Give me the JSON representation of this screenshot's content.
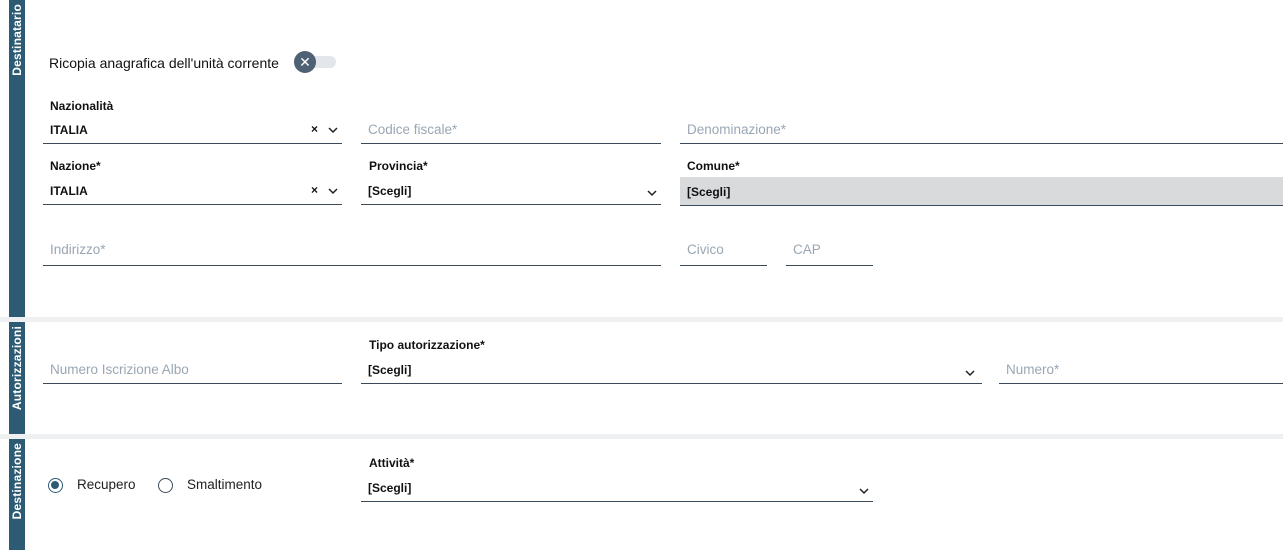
{
  "destinatario": {
    "section_label": "Destinatario",
    "copy_toggle_label": "Ricopia anagrafica dell'unità corrente",
    "nazionalita": {
      "label": "Nazionalità",
      "value": "ITALIA",
      "clear": "×"
    },
    "codice_fiscale": {
      "placeholder": "Codice fiscale*"
    },
    "denominazione": {
      "placeholder": "Denominazione*"
    },
    "nazione": {
      "label": "Nazione*",
      "value": "ITALIA",
      "clear": "×"
    },
    "provincia": {
      "label": "Provincia*",
      "value": "[Scegli]"
    },
    "comune": {
      "label": "Comune*",
      "value": "[Scegli]"
    },
    "indirizzo": {
      "placeholder": "Indirizzo*"
    },
    "civico": {
      "placeholder": "Civico"
    },
    "cap": {
      "placeholder": "CAP"
    }
  },
  "autorizzazioni": {
    "section_label": "Autorizzazioni",
    "numero_albo": {
      "placeholder": "Numero Iscrizione Albo"
    },
    "tipo_autorizzazione": {
      "label": "Tipo autorizzazione*",
      "value": "[Scegli]"
    },
    "numero": {
      "placeholder": "Numero*"
    }
  },
  "destinazione": {
    "section_label": "Destinazione",
    "radio_recupero": "Recupero",
    "radio_smaltimento": "Smaltimento",
    "attivita": {
      "label": "Attività*",
      "value": "[Scegli]"
    }
  },
  "colors": {
    "section_tab": "#2e5b74",
    "disabled_bg": "#d9dadb",
    "placeholder": "#9aa6b2"
  },
  "icons": {
    "toggle": "close-icon",
    "dropdown": "chevron-down-icon",
    "clear": "clear-icon"
  }
}
